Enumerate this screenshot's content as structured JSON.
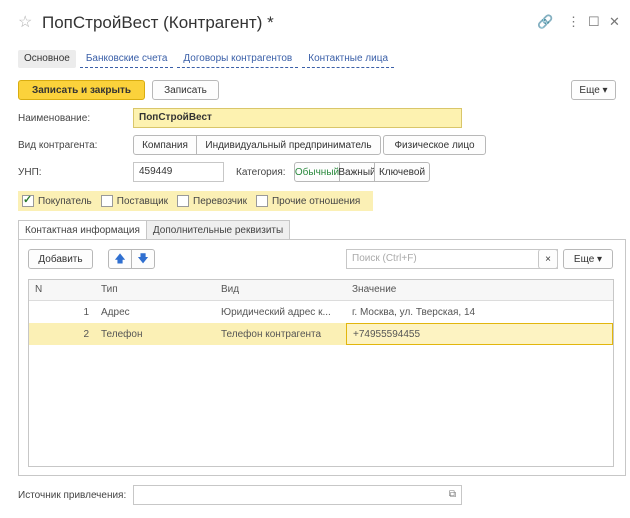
{
  "window": {
    "title": "ПопСтройВест (Контрагент) *",
    "icons": [
      "star-icon",
      "link-icon",
      "more-icon",
      "maximize-icon",
      "close-icon"
    ]
  },
  "top_tabs": [
    "Основное",
    "Банковские счета",
    "Договоры контрагентов",
    "Контактные лица"
  ],
  "toolbar": {
    "save_close": "Записать и закрыть",
    "save": "Записать",
    "more": "Еще ▾"
  },
  "form": {
    "name_label": "Наименование:",
    "name_value": "ПопСтройВест",
    "kind_label": "Вид контрагента:",
    "kind_options": [
      "Компания",
      "Индивидуальный предприниматель",
      "Физическое лицо"
    ],
    "unp_label": "УНП:",
    "unp_value": "459449",
    "category_label": "Категория:",
    "category_options": [
      "Обычный",
      "Важный",
      "Ключевой"
    ],
    "category_selected": "Обычный",
    "roles": [
      {
        "label": "Покупатель",
        "checked": true
      },
      {
        "label": "Поставщик",
        "checked": false
      },
      {
        "label": "Перевозчик",
        "checked": false
      },
      {
        "label": "Прочие отношения",
        "checked": false
      }
    ],
    "source_label": "Источник привлечения:"
  },
  "inner_tabs": [
    "Контактная информация",
    "Дополнительные реквизиты"
  ],
  "grid_toolbar": {
    "add": "Добавить",
    "up": "🡅",
    "down": "🡇",
    "search_placeholder": "Поиск (Ctrl+F)",
    "clear": "×",
    "more": "Еще ▾"
  },
  "table": {
    "columns": [
      "N",
      "Тип",
      "Вид",
      "Значение"
    ],
    "rows": [
      {
        "n": "1",
        "type": "Адрес",
        "kind": "Юридический адрес к...",
        "value": "г. Москва, ул. Тверская, 14"
      },
      {
        "n": "2",
        "type": "Телефон",
        "kind": "Телефон контрагента",
        "value": "+74955594455"
      }
    ]
  }
}
